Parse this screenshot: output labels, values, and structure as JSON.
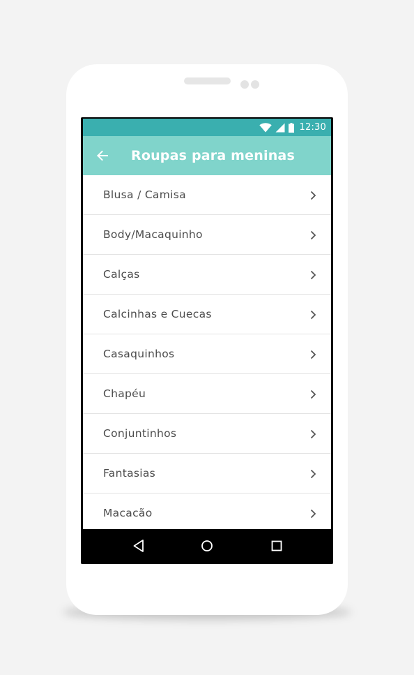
{
  "status_bar": {
    "time": "12:30",
    "icons": [
      "wifi-icon",
      "cellular-signal-icon",
      "battery-icon"
    ],
    "color": "#3aafaf"
  },
  "app_bar": {
    "title": "Roupas para meninas",
    "back_icon": "arrow-left-icon",
    "color": "#80d4cb"
  },
  "list": {
    "items": [
      {
        "label": "Blusa / Camisa"
      },
      {
        "label": "Body/Macaquinho"
      },
      {
        "label": "Calças"
      },
      {
        "label": "Calcinhas e Cuecas"
      },
      {
        "label": "Casaquinhos"
      },
      {
        "label": "Chapéu"
      },
      {
        "label": "Conjuntinhos"
      },
      {
        "label": "Fantasias"
      },
      {
        "label": "Macacão"
      }
    ],
    "trailing_icon": "chevron-right-icon"
  },
  "nav_bar": {
    "buttons": [
      "nav-back-icon",
      "nav-home-icon",
      "nav-recents-icon"
    ]
  }
}
